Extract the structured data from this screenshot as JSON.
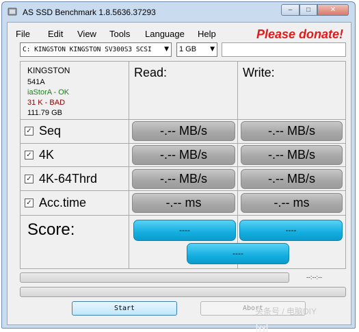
{
  "window": {
    "title": "AS SSD Benchmark 1.8.5636.37293",
    "minimize_glyph": "–",
    "maximize_glyph": "□",
    "close_glyph": "✕"
  },
  "menu": {
    "file": "File",
    "edit": "Edit",
    "view": "View",
    "tools": "Tools",
    "language": "Language",
    "help": "Help"
  },
  "donate": "Please donate!",
  "drive_select": {
    "value": "C: KINGSTON KINGSTON SV300S3 SCSI",
    "arrow": "▼"
  },
  "size_select": {
    "value": "1 GB",
    "arrow": "▼"
  },
  "drive_info": {
    "name": "KINGSTON",
    "firmware": "541A",
    "driver": "iaStorA - OK",
    "alignment": "31 K - BAD",
    "capacity": "111.79 GB"
  },
  "columns": {
    "read": "Read:",
    "write": "Write:"
  },
  "check_mark": "✓",
  "tests": [
    {
      "label": "Seq",
      "read": "-.-- MB/s",
      "write": "-.-- MB/s"
    },
    {
      "label": "4K",
      "read": "-.-- MB/s",
      "write": "-.-- MB/s"
    },
    {
      "label": "4K-64Thrd",
      "read": "-.-- MB/s",
      "write": "-.-- MB/s"
    },
    {
      "label": "Acc.time",
      "read": "-.-- ms",
      "write": "-.-- ms"
    }
  ],
  "score": {
    "label": "Score:",
    "read": "----",
    "write": "----",
    "total": "----"
  },
  "time_readout": "--:--:--",
  "buttons": {
    "start": "Start",
    "abort": "Abort"
  },
  "watermark": {
    "left": "头条号 / 电脑DIY",
    "right": "什龙网"
  },
  "colors": {
    "title_bar": "#c9dbef",
    "donate": "#e11b1b",
    "ok": "#1a7f1a",
    "bad": "#8b0000",
    "score_fill": "#14aee0"
  }
}
